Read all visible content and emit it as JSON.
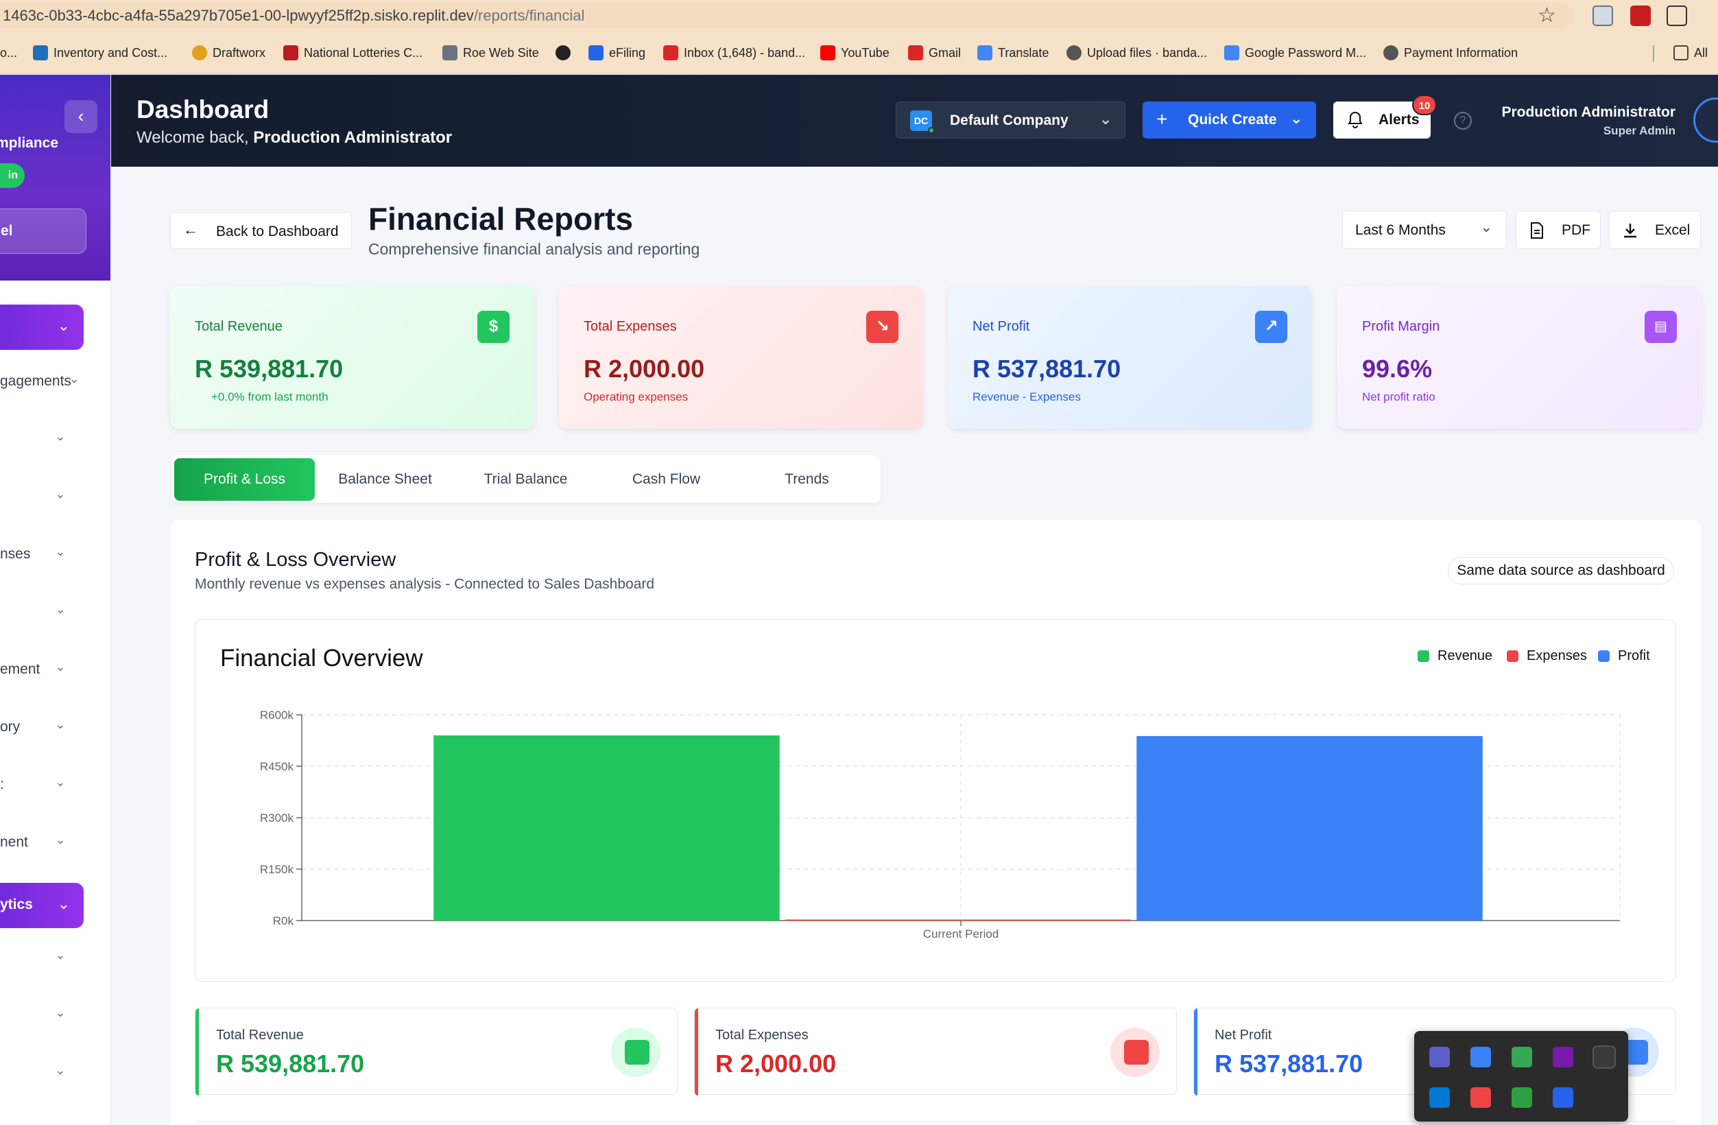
{
  "browser": {
    "url_host": "1463c-0b33-4cbc-a4fa-55a297b705e1-00-lpwyyf25ff2p.sisko.replit.dev",
    "url_path": "/reports/financial",
    "bookmarks": [
      {
        "label": "o...",
        "icon": "page-icon"
      },
      {
        "label": "Inventory and Cost...",
        "icon": "ac-icon"
      },
      {
        "label": "Draftworx",
        "icon": "chrome-icon"
      },
      {
        "label": "National Lotteries C...",
        "icon": "flag-icon"
      },
      {
        "label": "Roe Web Site",
        "icon": "image-icon"
      },
      {
        "label": "",
        "icon": "globe-icon"
      },
      {
        "label": "eFiling",
        "icon": "efiling-icon"
      },
      {
        "label": "Inbox (1,648) - band...",
        "icon": "gmail-icon"
      },
      {
        "label": "YouTube",
        "icon": "youtube-icon"
      },
      {
        "label": "Gmail",
        "icon": "gmail-icon"
      },
      {
        "label": "Translate",
        "icon": "translate-icon"
      },
      {
        "label": "Upload files · banda...",
        "icon": "github-icon"
      },
      {
        "label": "Google Password M...",
        "icon": "key-icon"
      },
      {
        "label": "Payment Information",
        "icon": "github-icon"
      },
      {
        "label": "All",
        "icon": "folder-icon"
      }
    ]
  },
  "sidebar": {
    "compliance_label": "mpliance",
    "badge_label": "in",
    "panel_label": "el",
    "items": [
      {
        "label": "gagements",
        "top": 0
      },
      {
        "label": ""
      },
      {
        "label": ""
      },
      {
        "label": "nses"
      },
      {
        "label": ""
      },
      {
        "label": "ement"
      },
      {
        "label": "ory"
      },
      {
        "label": ":"
      },
      {
        "label": "nent"
      },
      {
        "label": "ytics"
      },
      {
        "label": ""
      },
      {
        "label": ""
      },
      {
        "label": ""
      }
    ]
  },
  "header": {
    "title": "Dashboard",
    "welcome_prefix": "Welcome back,",
    "welcome_user": "Production Administrator",
    "company_initials": "DC",
    "company_name": "Default Company",
    "quick_create_label": "Quick Create",
    "alerts_label": "Alerts",
    "alerts_count": "10",
    "help_glyph": "?",
    "user_name": "Production Administrator",
    "user_role": "Super Admin"
  },
  "page": {
    "back_label": "Back to Dashboard",
    "title": "Financial Reports",
    "subtitle": "Comprehensive financial analysis and reporting",
    "period_label": "Last 6 Months",
    "pdf_label": "PDF",
    "excel_label": "Excel"
  },
  "kpis": [
    {
      "label": "Total Revenue",
      "value": "R 539,881.70",
      "note": "+0.0% from last month",
      "icon": "dollar-icon",
      "glyph": "$"
    },
    {
      "label": "Total Expenses",
      "value": "R 2,000.00",
      "note": "Operating expenses",
      "icon": "trending-down-icon",
      "glyph": "↘"
    },
    {
      "label": "Net Profit",
      "value": "R 537,881.70",
      "note": "Revenue - Expenses",
      "icon": "trending-up-icon",
      "glyph": "↗"
    },
    {
      "label": "Profit Margin",
      "value": "99.6%",
      "note": "Net profit ratio",
      "icon": "document-icon",
      "glyph": "▤"
    }
  ],
  "tabs": [
    {
      "label": "Profit & Loss",
      "active": true
    },
    {
      "label": "Balance Sheet",
      "active": false
    },
    {
      "label": "Trial Balance",
      "active": false
    },
    {
      "label": "Cash Flow",
      "active": false
    },
    {
      "label": "Trends",
      "active": false
    }
  ],
  "panel": {
    "title": "Profit & Loss Overview",
    "subtitle": "Monthly revenue vs expenses analysis - Connected to Sales Dashboard",
    "source_badge": "Same data source as dashboard"
  },
  "chart_data": {
    "type": "bar",
    "title": "Financial Overview",
    "categories": [
      "Current Period"
    ],
    "series": [
      {
        "name": "Revenue",
        "values": [
          539881.7
        ],
        "color": "#22c55e"
      },
      {
        "name": "Expenses",
        "values": [
          2000
        ],
        "color": "#ef4444"
      },
      {
        "name": "Profit",
        "values": [
          537881.7
        ],
        "color": "#3b82f6"
      }
    ],
    "y_ticks": [
      "R0k",
      "R150k",
      "R300k",
      "R450k",
      "R600k"
    ],
    "ylim": [
      0,
      600000
    ],
    "grid": true,
    "legend_position": "top-right"
  },
  "summary": [
    {
      "label": "Total Revenue",
      "value": "R 539,881.70",
      "color": "#22c55e",
      "bg": "#dcfce7"
    },
    {
      "label": "Total Expenses",
      "value": "R 2,000.00",
      "color": "#ef4444",
      "bg": "#fee2e2"
    },
    {
      "label": "Net Profit",
      "value": "R 537,881.70",
      "color": "#3b82f6",
      "bg": "#dbeafe"
    }
  ],
  "tray_icons": [
    "teams-icon",
    "window-icon",
    "drive-icon",
    "onenote-icon",
    "pen-icon",
    "app-icon",
    "media-icon",
    "defender-icon",
    "bluetooth-icon"
  ]
}
